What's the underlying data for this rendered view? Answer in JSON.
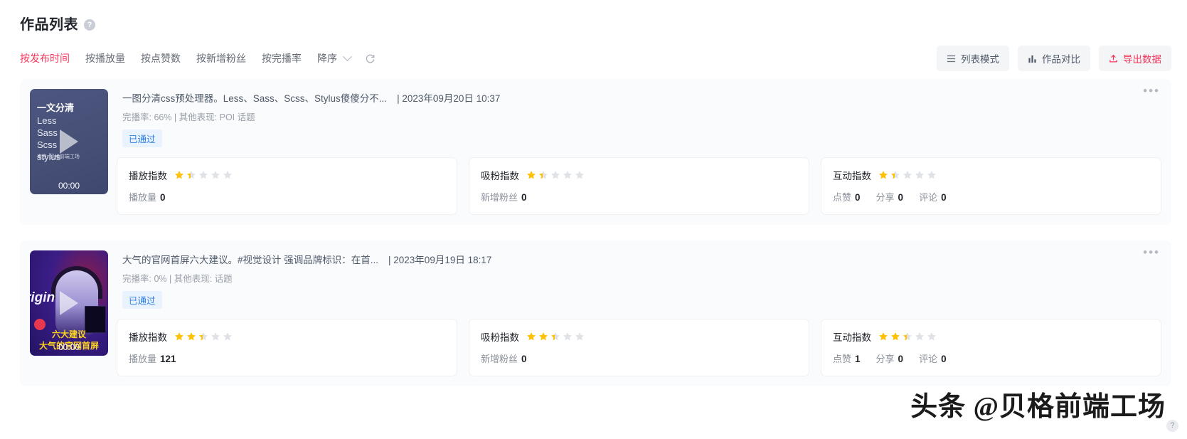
{
  "header": {
    "title": "作品列表",
    "help_icon": "question-mark-icon"
  },
  "toolbar": {
    "filters": [
      {
        "label": "按发布时间",
        "active": true
      },
      {
        "label": "按播放量",
        "active": false
      },
      {
        "label": "按点赞数",
        "active": false
      },
      {
        "label": "按新增粉丝",
        "active": false
      },
      {
        "label": "按完播率",
        "active": false
      }
    ],
    "order_label": "降序",
    "refresh_icon": "refresh-icon",
    "buttons": [
      {
        "label": "列表模式",
        "icon": "list-icon"
      },
      {
        "label": "作品对比",
        "icon": "bar-chart-icon"
      },
      {
        "label": "导出数据",
        "icon": "upload-icon"
      }
    ],
    "accent_color": "#f5365c"
  },
  "cards": [
    {
      "thumbnail": {
        "title": "一文分清",
        "lines": "Less\nSass\nScss\nstylus",
        "source": "来自: 贝格前端工场",
        "duration": "00:00"
      },
      "title": "一图分清css预处理器。Less、Sass、Scss、Stylus傻傻分不...",
      "date": "| 2023年09月20日 10:37",
      "subinfo": "完播率: 66% | 其他表现: POI 话题",
      "badge": "已通过",
      "more_icon": "more-horizontal-icon",
      "metrics": [
        {
          "label": "播放指数",
          "rating": 1.4,
          "values": [
            {
              "name": "播放量",
              "value": "0"
            }
          ]
        },
        {
          "label": "吸粉指数",
          "rating": 1.4,
          "values": [
            {
              "name": "新增粉丝",
              "value": "0"
            }
          ]
        },
        {
          "label": "互动指数",
          "rating": 1.4,
          "values": [
            {
              "name": "点赞",
              "value": "0"
            },
            {
              "name": "分享",
              "value": "0"
            },
            {
              "name": "评论",
              "value": "0"
            }
          ]
        }
      ]
    },
    {
      "thumbnail": {
        "title": "rigin",
        "caption1": "六大建议",
        "caption2": "大气的官网首屏",
        "duration": "00:00"
      },
      "title": "大气的官网首屏六大建议。#视觉设计 强调品牌标识：在首...",
      "date": "| 2023年09月19日 18:17",
      "subinfo": "完播率: 0% | 其他表现: 话题",
      "badge": "已通过",
      "more_icon": "more-horizontal-icon",
      "metrics": [
        {
          "label": "播放指数",
          "rating": 2.4,
          "values": [
            {
              "name": "播放量",
              "value": "121"
            }
          ]
        },
        {
          "label": "吸粉指数",
          "rating": 2.4,
          "values": [
            {
              "name": "新增粉丝",
              "value": "0"
            }
          ]
        },
        {
          "label": "互动指数",
          "rating": 2.4,
          "values": [
            {
              "name": "点赞",
              "value": "1"
            },
            {
              "name": "分享",
              "value": "0"
            },
            {
              "name": "评论",
              "value": "0"
            }
          ]
        }
      ]
    }
  ],
  "watermark": "头条 @贝格前端工场",
  "help_fab": "?"
}
